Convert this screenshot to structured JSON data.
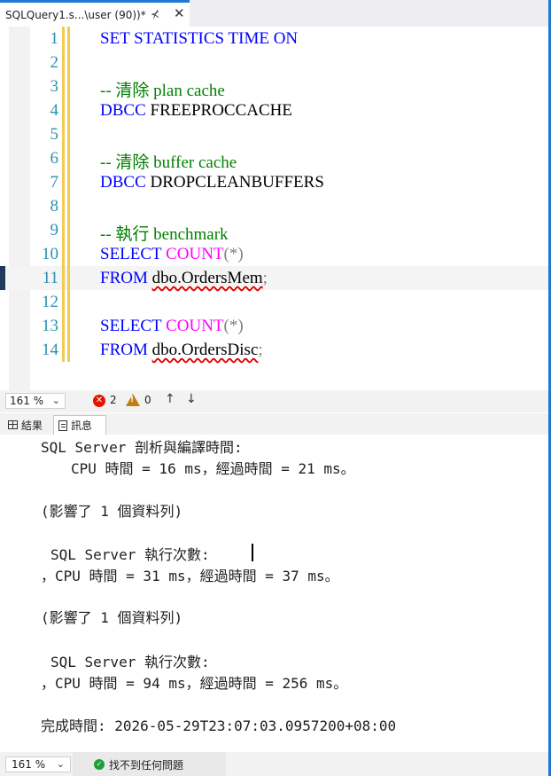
{
  "tab": {
    "title": "SQLQuery1.s...\\user (90))*",
    "pin_glyph": "⊀",
    "close_glyph": "✕"
  },
  "editor": {
    "current_line": 11,
    "lines": [
      {
        "num": "1",
        "parts": [
          {
            "t": "SET STATISTICS TIME ON",
            "c": "kw"
          }
        ]
      },
      {
        "num": "2",
        "parts": []
      },
      {
        "num": "3",
        "parts": [
          {
            "t": "-- 清除 plan cache",
            "c": "cm"
          }
        ]
      },
      {
        "num": "4",
        "parts": [
          {
            "t": "DBCC",
            "c": "kw"
          },
          {
            "t": " FREEPROCCACHE",
            "c": "tx"
          }
        ]
      },
      {
        "num": "5",
        "parts": []
      },
      {
        "num": "6",
        "parts": [
          {
            "t": "-- 清除 buffer cache",
            "c": "cm"
          }
        ]
      },
      {
        "num": "7",
        "parts": [
          {
            "t": "DBCC",
            "c": "kw"
          },
          {
            "t": " DROPCLEANBUFFERS",
            "c": "tx"
          }
        ]
      },
      {
        "num": "8",
        "parts": []
      },
      {
        "num": "9",
        "parts": [
          {
            "t": "-- 執行 benchmark",
            "c": "cm"
          }
        ]
      },
      {
        "num": "10",
        "parts": [
          {
            "t": "SELECT ",
            "c": "kw"
          },
          {
            "t": "COUNT",
            "c": "fn"
          },
          {
            "t": "(*)",
            "c": "gr"
          }
        ]
      },
      {
        "num": "11",
        "parts": [
          {
            "t": "FROM ",
            "c": "kw"
          },
          {
            "t": "dbo.OrdersMem",
            "c": "tx squig"
          },
          {
            "t": ";",
            "c": "gr"
          }
        ]
      },
      {
        "num": "12",
        "parts": []
      },
      {
        "num": "13",
        "parts": [
          {
            "t": "SELECT ",
            "c": "kw"
          },
          {
            "t": "COUNT",
            "c": "fn"
          },
          {
            "t": "(*)",
            "c": "gr"
          }
        ]
      },
      {
        "num": "14",
        "parts": [
          {
            "t": "FROM ",
            "c": "kw"
          },
          {
            "t": "dbo.OrdersDisc",
            "c": "tx squig"
          },
          {
            "t": ";",
            "c": "gr"
          }
        ]
      }
    ]
  },
  "editor_status": {
    "zoom": "161 %",
    "errors": "2",
    "warnings": "0",
    "error_icon": "error-icon",
    "warning_icon": "warning-icon"
  },
  "result_tabs": {
    "results": "結果",
    "messages": "訊息"
  },
  "messages": [
    {
      "text": "SQL Server 剖析與編譯時間:"
    },
    {
      "text": "CPU 時間 = 16 ms，經過時間 = 21 ms。"
    },
    {
      "text": "(影響了 1 個資料列)"
    },
    {
      "text": "SQL Server 執行次數:"
    },
    {
      "text": "，CPU 時間 = 31 ms，經過時間 = 37 ms。"
    },
    {
      "text": "(影響了 1 個資料列)"
    },
    {
      "text": "SQL Server 執行次數:"
    },
    {
      "text": "，CPU 時間 = 94 ms，經過時間 = 256 ms。"
    },
    {
      "text": "完成時間: 2026-05-29T23:07:03.0957200+08:00"
    }
  ],
  "bottom_status": {
    "zoom": "161 %",
    "status_text": "找不到任何問題",
    "status_icon": "check-circle-icon"
  },
  "colors": {
    "accent": "#1e78d4",
    "keyword": "#0000ff",
    "function": "#ff00ff",
    "comment": "#008000",
    "line_number": "#2b91af"
  }
}
